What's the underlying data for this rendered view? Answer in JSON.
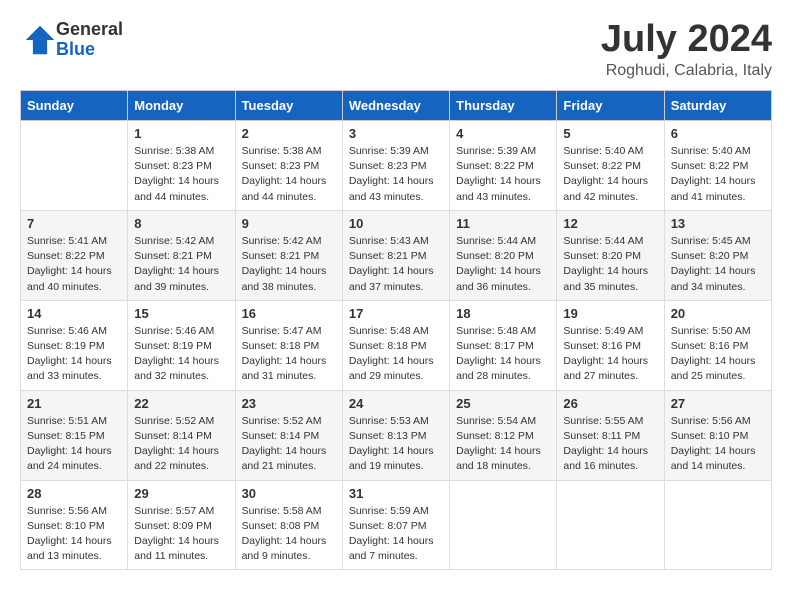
{
  "logo": {
    "general": "General",
    "blue": "Blue"
  },
  "title": "July 2024",
  "subtitle": "Roghudi, Calabria, Italy",
  "days_header": [
    "Sunday",
    "Monday",
    "Tuesday",
    "Wednesday",
    "Thursday",
    "Friday",
    "Saturday"
  ],
  "weeks": [
    [
      {
        "day": "",
        "sunrise": "",
        "sunset": "",
        "daylight": ""
      },
      {
        "day": "1",
        "sunrise": "Sunrise: 5:38 AM",
        "sunset": "Sunset: 8:23 PM",
        "daylight": "Daylight: 14 hours and 44 minutes."
      },
      {
        "day": "2",
        "sunrise": "Sunrise: 5:38 AM",
        "sunset": "Sunset: 8:23 PM",
        "daylight": "Daylight: 14 hours and 44 minutes."
      },
      {
        "day": "3",
        "sunrise": "Sunrise: 5:39 AM",
        "sunset": "Sunset: 8:23 PM",
        "daylight": "Daylight: 14 hours and 43 minutes."
      },
      {
        "day": "4",
        "sunrise": "Sunrise: 5:39 AM",
        "sunset": "Sunset: 8:22 PM",
        "daylight": "Daylight: 14 hours and 43 minutes."
      },
      {
        "day": "5",
        "sunrise": "Sunrise: 5:40 AM",
        "sunset": "Sunset: 8:22 PM",
        "daylight": "Daylight: 14 hours and 42 minutes."
      },
      {
        "day": "6",
        "sunrise": "Sunrise: 5:40 AM",
        "sunset": "Sunset: 8:22 PM",
        "daylight": "Daylight: 14 hours and 41 minutes."
      }
    ],
    [
      {
        "day": "7",
        "sunrise": "Sunrise: 5:41 AM",
        "sunset": "Sunset: 8:22 PM",
        "daylight": "Daylight: 14 hours and 40 minutes."
      },
      {
        "day": "8",
        "sunrise": "Sunrise: 5:42 AM",
        "sunset": "Sunset: 8:21 PM",
        "daylight": "Daylight: 14 hours and 39 minutes."
      },
      {
        "day": "9",
        "sunrise": "Sunrise: 5:42 AM",
        "sunset": "Sunset: 8:21 PM",
        "daylight": "Daylight: 14 hours and 38 minutes."
      },
      {
        "day": "10",
        "sunrise": "Sunrise: 5:43 AM",
        "sunset": "Sunset: 8:21 PM",
        "daylight": "Daylight: 14 hours and 37 minutes."
      },
      {
        "day": "11",
        "sunrise": "Sunrise: 5:44 AM",
        "sunset": "Sunset: 8:20 PM",
        "daylight": "Daylight: 14 hours and 36 minutes."
      },
      {
        "day": "12",
        "sunrise": "Sunrise: 5:44 AM",
        "sunset": "Sunset: 8:20 PM",
        "daylight": "Daylight: 14 hours and 35 minutes."
      },
      {
        "day": "13",
        "sunrise": "Sunrise: 5:45 AM",
        "sunset": "Sunset: 8:20 PM",
        "daylight": "Daylight: 14 hours and 34 minutes."
      }
    ],
    [
      {
        "day": "14",
        "sunrise": "Sunrise: 5:46 AM",
        "sunset": "Sunset: 8:19 PM",
        "daylight": "Daylight: 14 hours and 33 minutes."
      },
      {
        "day": "15",
        "sunrise": "Sunrise: 5:46 AM",
        "sunset": "Sunset: 8:19 PM",
        "daylight": "Daylight: 14 hours and 32 minutes."
      },
      {
        "day": "16",
        "sunrise": "Sunrise: 5:47 AM",
        "sunset": "Sunset: 8:18 PM",
        "daylight": "Daylight: 14 hours and 31 minutes."
      },
      {
        "day": "17",
        "sunrise": "Sunrise: 5:48 AM",
        "sunset": "Sunset: 8:18 PM",
        "daylight": "Daylight: 14 hours and 29 minutes."
      },
      {
        "day": "18",
        "sunrise": "Sunrise: 5:48 AM",
        "sunset": "Sunset: 8:17 PM",
        "daylight": "Daylight: 14 hours and 28 minutes."
      },
      {
        "day": "19",
        "sunrise": "Sunrise: 5:49 AM",
        "sunset": "Sunset: 8:16 PM",
        "daylight": "Daylight: 14 hours and 27 minutes."
      },
      {
        "day": "20",
        "sunrise": "Sunrise: 5:50 AM",
        "sunset": "Sunset: 8:16 PM",
        "daylight": "Daylight: 14 hours and 25 minutes."
      }
    ],
    [
      {
        "day": "21",
        "sunrise": "Sunrise: 5:51 AM",
        "sunset": "Sunset: 8:15 PM",
        "daylight": "Daylight: 14 hours and 24 minutes."
      },
      {
        "day": "22",
        "sunrise": "Sunrise: 5:52 AM",
        "sunset": "Sunset: 8:14 PM",
        "daylight": "Daylight: 14 hours and 22 minutes."
      },
      {
        "day": "23",
        "sunrise": "Sunrise: 5:52 AM",
        "sunset": "Sunset: 8:14 PM",
        "daylight": "Daylight: 14 hours and 21 minutes."
      },
      {
        "day": "24",
        "sunrise": "Sunrise: 5:53 AM",
        "sunset": "Sunset: 8:13 PM",
        "daylight": "Daylight: 14 hours and 19 minutes."
      },
      {
        "day": "25",
        "sunrise": "Sunrise: 5:54 AM",
        "sunset": "Sunset: 8:12 PM",
        "daylight": "Daylight: 14 hours and 18 minutes."
      },
      {
        "day": "26",
        "sunrise": "Sunrise: 5:55 AM",
        "sunset": "Sunset: 8:11 PM",
        "daylight": "Daylight: 14 hours and 16 minutes."
      },
      {
        "day": "27",
        "sunrise": "Sunrise: 5:56 AM",
        "sunset": "Sunset: 8:10 PM",
        "daylight": "Daylight: 14 hours and 14 minutes."
      }
    ],
    [
      {
        "day": "28",
        "sunrise": "Sunrise: 5:56 AM",
        "sunset": "Sunset: 8:10 PM",
        "daylight": "Daylight: 14 hours and 13 minutes."
      },
      {
        "day": "29",
        "sunrise": "Sunrise: 5:57 AM",
        "sunset": "Sunset: 8:09 PM",
        "daylight": "Daylight: 14 hours and 11 minutes."
      },
      {
        "day": "30",
        "sunrise": "Sunrise: 5:58 AM",
        "sunset": "Sunset: 8:08 PM",
        "daylight": "Daylight: 14 hours and 9 minutes."
      },
      {
        "day": "31",
        "sunrise": "Sunrise: 5:59 AM",
        "sunset": "Sunset: 8:07 PM",
        "daylight": "Daylight: 14 hours and 7 minutes."
      },
      {
        "day": "",
        "sunrise": "",
        "sunset": "",
        "daylight": ""
      },
      {
        "day": "",
        "sunrise": "",
        "sunset": "",
        "daylight": ""
      },
      {
        "day": "",
        "sunrise": "",
        "sunset": "",
        "daylight": ""
      }
    ]
  ]
}
